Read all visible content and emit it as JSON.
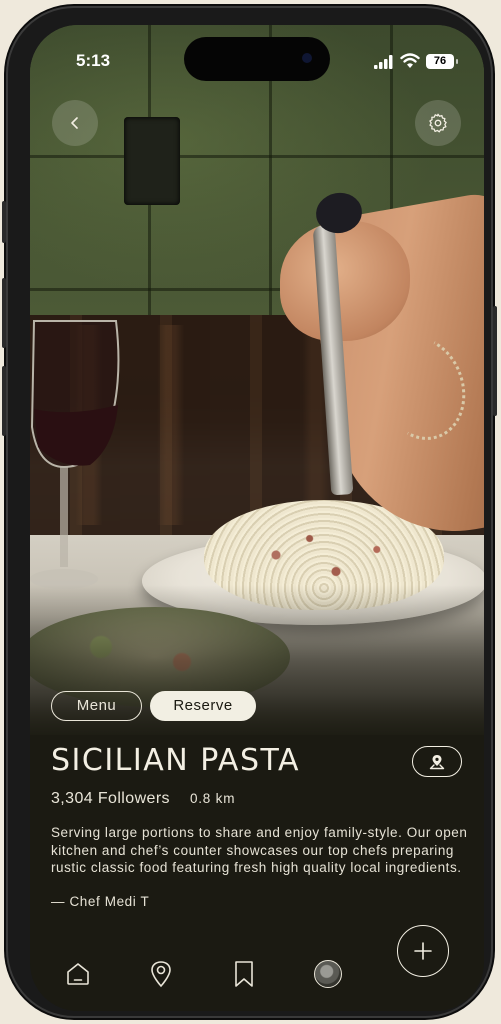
{
  "status_bar": {
    "time": "5:13",
    "battery": "76"
  },
  "header": {
    "back_icon": "chevron-left-icon",
    "settings_icon": "gear-icon"
  },
  "tabs": {
    "menu_label": "Menu",
    "reserve_label": "Reserve",
    "selected": "Reserve"
  },
  "restaurant": {
    "name": "SICILIAN PASTA",
    "followers": "3,304 Followers",
    "distance": "0.8 km",
    "description": "Serving large portions to share and enjoy family-style. Our open kitchen and chef’s counter showcases our top chefs preparing rustic classic food featuring fresh high quality local ingredients.",
    "signature": "— Chef Medi T",
    "map_icon": "map-pin-icon"
  },
  "actions": {
    "add_icon": "plus-icon"
  },
  "bottom_nav": {
    "items": [
      "home-icon",
      "location-icon",
      "bookmark-icon",
      "avatar"
    ]
  },
  "colors": {
    "background": "#1b1a12",
    "text": "#f3efe3",
    "chip_fill": "#f2efe3"
  }
}
